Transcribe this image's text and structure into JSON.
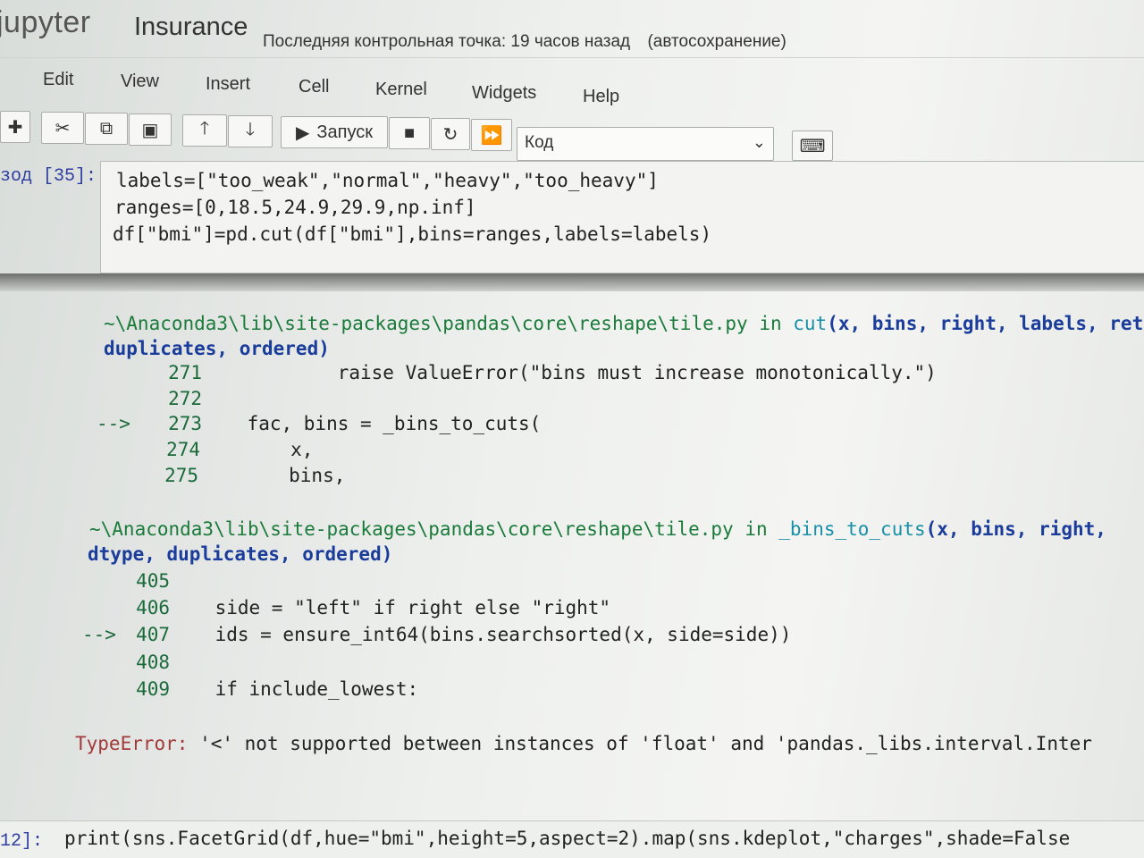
{
  "header": {
    "logo": "jupyter",
    "notebook_name": "Insurance",
    "checkpoint": "Последняя контрольная точка: 19 часов назад",
    "autosave": "(автосохранение)"
  },
  "menu": [
    "Edit",
    "View",
    "Insert",
    "Cell",
    "Kernel",
    "Widgets",
    "Help"
  ],
  "toolbar": {
    "run_label": "Запуск",
    "cell_type": "Код"
  },
  "cell35": {
    "prompt": "зод [35]:",
    "lines": [
      "labels=[\"too_weak\",\"normal\",\"heavy\",\"too_heavy\"]",
      "ranges=[0,18.5,24.9,29.9,np.inf]",
      "df[\"bmi\"]=pd.cut(df[\"bmi\"],bins=ranges,labels=labels)"
    ]
  },
  "traceback": {
    "frame1": {
      "path": "~\\Anaconda3\\lib\\site-packages\\pandas\\core\\reshape\\tile.py",
      "in_word": "in",
      "func": "cut",
      "args1": "(x, bins, right, labels, ret",
      "args2": "duplicates, ordered)",
      "lines": [
        {
          "marker": "",
          "num": "271",
          "code": "            raise ValueError(\"bins must increase monotonically.\")"
        },
        {
          "marker": "",
          "num": "272",
          "code": ""
        },
        {
          "marker": "-->",
          "num": "273",
          "code": "    fac, bins = _bins_to_cuts("
        },
        {
          "marker": "",
          "num": "274",
          "code": "        x,"
        },
        {
          "marker": "",
          "num": "275",
          "code": "        bins,"
        }
      ]
    },
    "frame2": {
      "path": "~\\Anaconda3\\lib\\site-packages\\pandas\\core\\reshape\\tile.py",
      "in_word": "in",
      "func": "_bins_to_cuts",
      "args1": "(x, bins, right,",
      "args2": "dtype, duplicates, ordered)",
      "lines": [
        {
          "marker": "",
          "num": "405",
          "code": ""
        },
        {
          "marker": "",
          "num": "406",
          "code": "    side = \"left\" if right else \"right\""
        },
        {
          "marker": "-->",
          "num": "407",
          "code": "    ids = ensure_int64(bins.searchsorted(x, side=side))"
        },
        {
          "marker": "",
          "num": "408",
          "code": ""
        },
        {
          "marker": "",
          "num": "409",
          "code": "    if include_lowest:"
        }
      ]
    },
    "error_type": "TypeError:",
    "error_msg": "'<' not supported between instances of 'float' and 'pandas._libs.interval.Inter"
  },
  "cell12": {
    "prompt": "12]:",
    "code": "print(sns.FacetGrid(df,hue=\"bmi\",height=5,aspect=2).map(sns.kdeplot,\"charges\",shade=False"
  }
}
